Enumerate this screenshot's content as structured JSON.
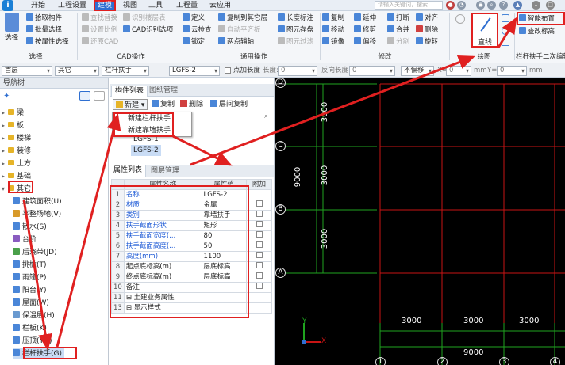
{
  "app": {
    "logo_text": "i"
  },
  "menu": [
    "开始",
    "工程设置",
    "建模",
    "视图",
    "工具",
    "工程量",
    "云应用"
  ],
  "search_placeholder": "请输入关键词，搜索...",
  "ribbon": {
    "select": {
      "label": "选择",
      "items": [
        "拾取构件",
        "批量选择",
        "按属性选择"
      ],
      "group": "选择"
    },
    "cad": {
      "items": [
        "查找替换",
        "设置比例",
        "还原CAD",
        "识别楼层表",
        "CAD识别选项"
      ],
      "group": "CAD操作"
    },
    "general": {
      "items": [
        "定义",
        "云检查",
        "锁定",
        "复制到其它层",
        "自动平齐板",
        "两点辅轴",
        "长度标注",
        "图元存盘",
        "图元过滤"
      ],
      "group": "通用操作"
    },
    "modify": {
      "items": [
        "复制",
        "移动",
        "镜像",
        "延伸",
        "修剪",
        "偏移",
        "打断",
        "合并",
        "分割",
        "对齐",
        "删除",
        "旋转"
      ],
      "group": "修改"
    },
    "draw": {
      "label": "直线",
      "group": "绘图"
    },
    "railing": {
      "items": [
        "智能布置",
        "查改标高"
      ],
      "group": "栏杆扶手二次编辑"
    }
  },
  "optbar": {
    "floor": "首层",
    "type": "其它",
    "component": "栏杆扶手",
    "name": "LGFS-2",
    "point_length_label": "点加长度",
    "length_label": "长度:",
    "length_value": "0",
    "reverse_length_label": "反向长度:",
    "reverse_length_value": "0",
    "offset_mode": "不偏移",
    "x_label": "X=",
    "x_value": "0",
    "x_unit": "mm",
    "y_label": "Y=",
    "y_value": "0",
    "y_unit": "mm"
  },
  "nav": {
    "title": "导航树",
    "items": [
      {
        "label": "梁",
        "type": "folder",
        "expanded": false
      },
      {
        "label": "板",
        "type": "folder",
        "expanded": false
      },
      {
        "label": "楼梯",
        "type": "folder",
        "expanded": false
      },
      {
        "label": "装修",
        "type": "folder",
        "expanded": false
      },
      {
        "label": "土方",
        "type": "folder",
        "expanded": false
      },
      {
        "label": "基础",
        "type": "folder",
        "expanded": false
      },
      {
        "label": "其它",
        "type": "folder",
        "expanded": true
      },
      {
        "label": "建筑面积(U)",
        "type": "sub",
        "color": "#4a86d8"
      },
      {
        "label": "平整场地(V)",
        "type": "sub",
        "color": "#d89a2a"
      },
      {
        "label": "散水(S)",
        "type": "sub",
        "color": "#4a86d8"
      },
      {
        "label": "台阶",
        "type": "sub",
        "color": "#8a5cc0"
      },
      {
        "label": "后浇带(JD)",
        "type": "sub",
        "color": "#4aa04a"
      },
      {
        "label": "挑檐(T)",
        "type": "sub",
        "color": "#4a86d8"
      },
      {
        "label": "雨篷(P)",
        "type": "sub",
        "color": "#4a86d8"
      },
      {
        "label": "阳台(Y)",
        "type": "sub",
        "color": "#4a86d8"
      },
      {
        "label": "屋面(W)",
        "type": "sub",
        "color": "#4a86d8"
      },
      {
        "label": "保温层(H)",
        "type": "sub",
        "color": "#6a9ad0"
      },
      {
        "label": "栏板(K)",
        "type": "sub",
        "color": "#4a86d8"
      },
      {
        "label": "压顶(YD)",
        "type": "sub",
        "color": "#4a86d8"
      },
      {
        "label": "栏杆扶手(G)",
        "type": "sub",
        "color": "#4a86d8",
        "selected": true
      }
    ]
  },
  "components": {
    "tabs": [
      "构件列表",
      "图纸管理"
    ],
    "toolbar": {
      "new": "新建",
      "copy": "复制",
      "delete": "删除",
      "floor_copy": "层间复制"
    },
    "dropdown": [
      "新建栏杆扶手",
      "新建靠墙扶手"
    ],
    "list": [
      "LGFS-1",
      "LGFS-2"
    ]
  },
  "properties": {
    "tabs": [
      "属性列表",
      "图层管理"
    ],
    "headers": [
      "属性名称",
      "属性值",
      "附加"
    ],
    "rows": [
      {
        "no": "1",
        "name": "名称",
        "value": "LGFS-2",
        "check": false,
        "blue": true
      },
      {
        "no": "2",
        "name": "材质",
        "value": "金属",
        "check": true,
        "blue": true
      },
      {
        "no": "3",
        "name": "类别",
        "value": "靠墙扶手",
        "check": true,
        "blue": true
      },
      {
        "no": "4",
        "name": "扶手截面形状",
        "value": "矩形",
        "check": true,
        "blue": true
      },
      {
        "no": "5",
        "name": "扶手截面宽度(...",
        "value": "80",
        "check": true,
        "blue": true
      },
      {
        "no": "6",
        "name": "扶手截面高度(...",
        "value": "50",
        "check": true,
        "blue": true
      },
      {
        "no": "7",
        "name": "高度(mm)",
        "value": "1100",
        "check": true,
        "blue": true
      },
      {
        "no": "8",
        "name": "起点底标高(m)",
        "value": "层底标高",
        "check": true,
        "blue": false
      },
      {
        "no": "9",
        "name": "终点底标高(m)",
        "value": "层底标高",
        "check": true,
        "blue": false
      },
      {
        "no": "10",
        "name": "备注",
        "value": "",
        "check": true,
        "blue": false
      },
      {
        "no": "11",
        "name": "土建业务属性",
        "value": "",
        "check": false,
        "blue": false,
        "group": true
      },
      {
        "no": "13",
        "name": "显示样式",
        "value": "",
        "check": false,
        "blue": false,
        "group": true
      }
    ]
  },
  "canvas": {
    "axes_rows": [
      "D",
      "C",
      "B",
      "A"
    ],
    "axes_cols": [
      "1",
      "2",
      "3",
      "4"
    ],
    "dims_vertical": [
      "3000",
      "3000",
      "3000",
      "9000"
    ],
    "dims_horizontal": [
      "3000",
      "3000",
      "3000",
      "9000"
    ],
    "axis_x": "X",
    "axis_y": "Y"
  },
  "colors": {
    "accent": "#2f6fd1",
    "highlight": "#e02020",
    "grid_red": "#c81414",
    "grid_green": "#1fa31f"
  }
}
